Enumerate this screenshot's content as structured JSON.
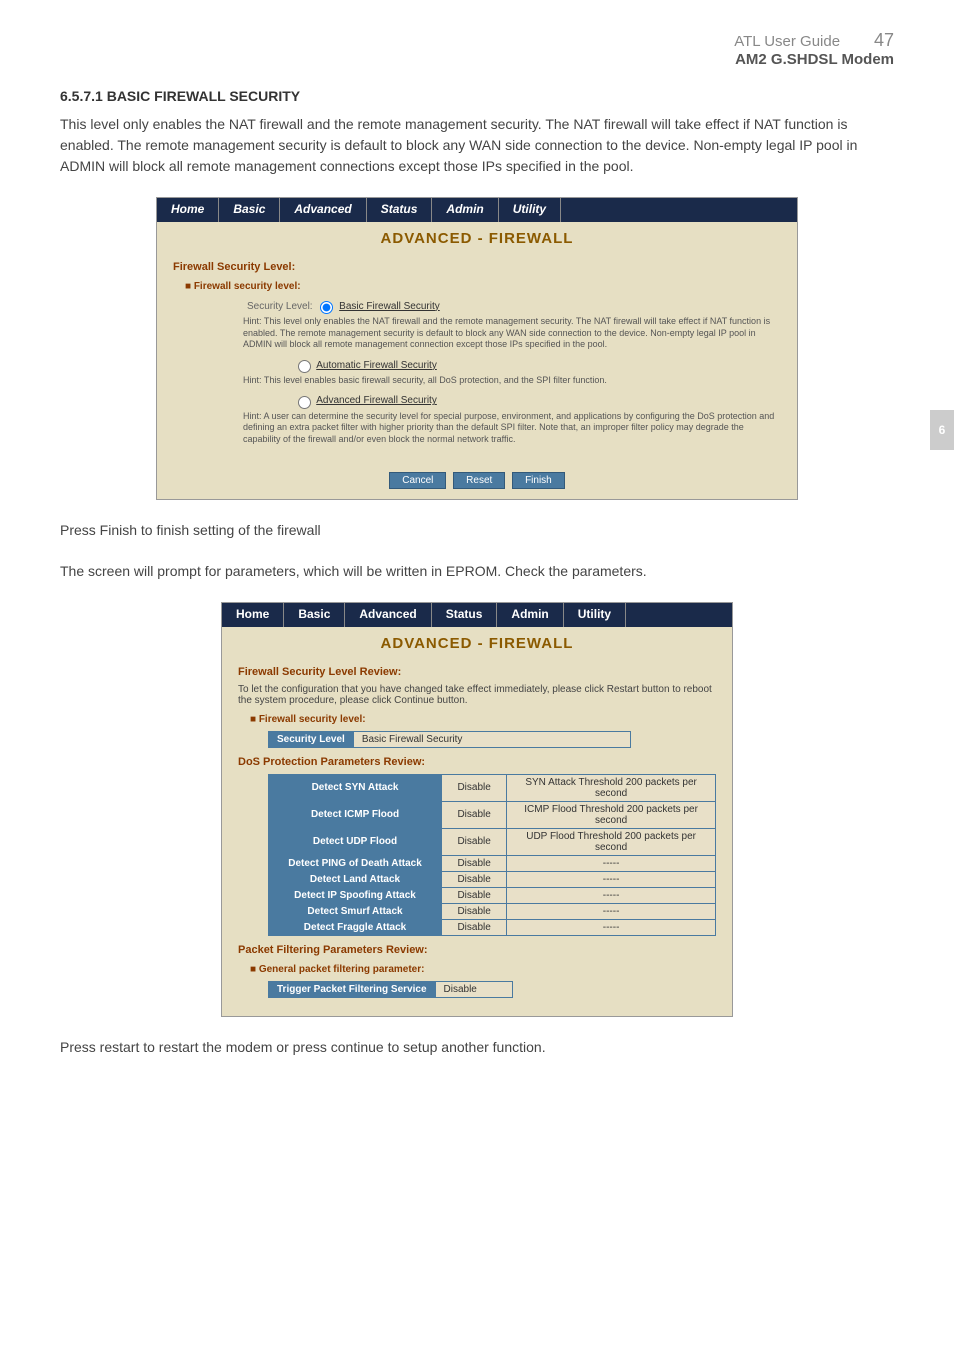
{
  "header": {
    "guide": "ATL User Guide",
    "pagenum": "47",
    "model": "AM2 G.SHDSL Modem"
  },
  "side_tab": "6",
  "section": {
    "heading": "6.5.7.1 BASIC FIREWALL SECURITY",
    "p1": "This level only enables the NAT firewall and the remote management security. The NAT firewall will take effect if NAT function is enabled. The remote management security is default to block any WAN side connection to the device. Non-empty legal IP pool in ADMIN will block all remote management connections except those IPs specified in the pool.",
    "p2": "Press Finish to finish setting of the firewall",
    "p3": "The screen will prompt for parameters, which will be written in EPROM. Check the parameters.",
    "p4": "Press restart to restart the modem or press continue to setup another function."
  },
  "nav": {
    "home": "Home",
    "basic": "Basic",
    "advanced": "Advanced",
    "status": "Status",
    "admin": "Admin",
    "utility": "Utility"
  },
  "screen1": {
    "title": "ADVANCED - FIREWALL",
    "section_label": "Firewall Security Level:",
    "bullet": "Firewall security level:",
    "level_label": "Security Level:",
    "opt1": "Basic Firewall Security",
    "hint1": "Hint: This level only enables the NAT firewall and the remote management security. The NAT firewall will take effect if NAT function is enabled. The remote management security is default to block any WAN side connection to the device. Non-empty legal IP pool in ADMIN will block all remote management connection except those IPs specified in the pool.",
    "opt2": "Automatic Firewall Security",
    "hint2": "Hint: This level enables basic firewall security, all DoS protection, and the SPI filter function.",
    "opt3": "Advanced Firewall Security",
    "hint3": "Hint: A user can determine the security level for special purpose, environment, and applications by configuring the DoS protection and defining an extra packet filter with higher priority than the default SPI filter. Note that, an improper filter policy may degrade the capability of the firewall and/or even block the normal network traffic.",
    "btn_cancel": "Cancel",
    "btn_reset": "Reset",
    "btn_finish": "Finish"
  },
  "screen2": {
    "title": "ADVANCED - FIREWALL",
    "review_label": "Firewall Security Level Review:",
    "review_text": "To let the configuration that you have changed take effect immediately, please click Restart button to reboot the system procedure, please click Continue button.",
    "bullet1": "Firewall security level:",
    "sec_level_header": "Security Level",
    "sec_level_value": "Basic Firewall Security",
    "dos_label": "DoS Protection Parameters Review:",
    "dos_rows": [
      {
        "name": "Detect SYN Attack",
        "status": "Disable",
        "note": "SYN Attack Threshold 200 packets per second"
      },
      {
        "name": "Detect ICMP Flood",
        "status": "Disable",
        "note": "ICMP Flood Threshold 200 packets per second"
      },
      {
        "name": "Detect UDP Flood",
        "status": "Disable",
        "note": "UDP Flood Threshold 200 packets per second"
      },
      {
        "name": "Detect PING of Death Attack",
        "status": "Disable",
        "note": "-----"
      },
      {
        "name": "Detect Land Attack",
        "status": "Disable",
        "note": "-----"
      },
      {
        "name": "Detect IP Spoofing Attack",
        "status": "Disable",
        "note": "-----"
      },
      {
        "name": "Detect Smurf Attack",
        "status": "Disable",
        "note": "-----"
      },
      {
        "name": "Detect Fraggle Attack",
        "status": "Disable",
        "note": "-----"
      }
    ],
    "packet_label": "Packet Filtering Parameters Review:",
    "bullet2": "General packet filtering parameter:",
    "trigger_header": "Trigger Packet Filtering Service",
    "trigger_value": "Disable"
  }
}
